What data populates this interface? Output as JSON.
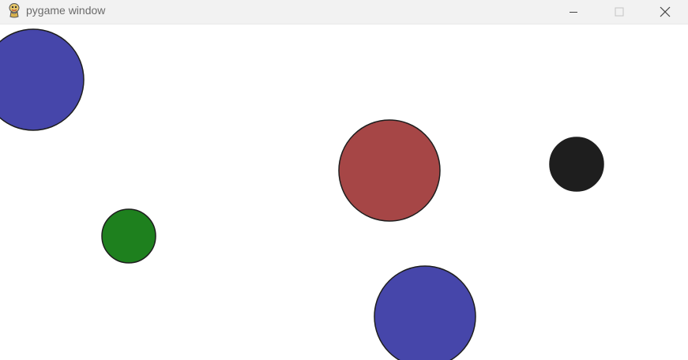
{
  "window": {
    "title": "pygame window",
    "icon": "pygame-snake-icon",
    "controls": {
      "minimize_icon": "minimize-icon",
      "maximize_icon": "maximize-icon",
      "close_icon": "close-icon"
    }
  },
  "scene": {
    "background": "#ffffff",
    "outline_color": "#1e1e1e",
    "circles": [
      {
        "name": "blue-circle-top-left",
        "color": "#4646aa"
      },
      {
        "name": "red-circle",
        "color": "#a64646"
      },
      {
        "name": "black-circle",
        "color": "#1e1e1e"
      },
      {
        "name": "green-circle",
        "color": "#1e801e"
      },
      {
        "name": "blue-circle-bottom",
        "color": "#4646aa"
      }
    ]
  }
}
